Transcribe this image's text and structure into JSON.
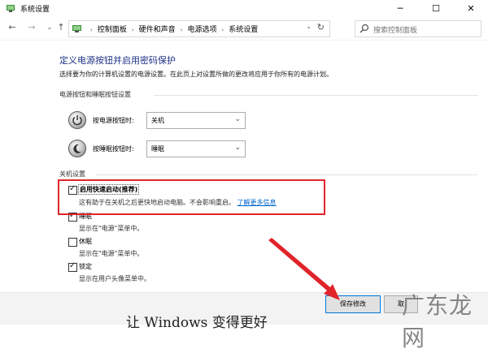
{
  "window": {
    "title": "系统设置",
    "minimize": "─",
    "maximize": "☐",
    "close": "✕"
  },
  "nav": {
    "back": "←",
    "forward": "→",
    "dropdown": "⌄",
    "up": "↑"
  },
  "address": {
    "crumbs": [
      "控制面板",
      "硬件和声音",
      "电源选项",
      "系统设置"
    ],
    "separator": "›",
    "dropdown": "⌄",
    "refresh": "↻"
  },
  "search": {
    "placeholder": "搜索控制面板"
  },
  "heading": "定义电源按钮并启用密码保护",
  "description": "选择要为你的计算机设置的电源设置。在此页上对设置所做的更改将应用于你所有的电源计划。",
  "power_section": {
    "label": "电源按钮和睡眠按钮设置",
    "power_button": {
      "label": "按电源按钮时:",
      "value": "关机"
    },
    "sleep_button": {
      "label": "按睡眠按钮时:",
      "value": "睡眠"
    }
  },
  "shutdown_section": {
    "label": "关机设置",
    "items": [
      {
        "label": "启用快速启动(推荐)",
        "checked": true,
        "desc": "这有助于在关机之后更快地启动电脑。不会影响重启。",
        "link": "了解更多信息"
      },
      {
        "label": "睡眠",
        "checked": true,
        "desc": "显示在\"电源\"菜单中。"
      },
      {
        "label": "休眠",
        "checked": false,
        "desc": "显示在\"电源\"菜单中。"
      },
      {
        "label": "锁定",
        "checked": true,
        "desc": "显示在用户头像菜单中。"
      }
    ]
  },
  "buttons": {
    "save": "保存修改",
    "cancel": "取"
  },
  "overlay_text": "让 Windows 变得更好",
  "watermark": "广东龙网",
  "colors": {
    "heading": "#1e3287",
    "highlight": "#e0242b",
    "arrow": "#e0242b",
    "link": "#0066cc"
  }
}
